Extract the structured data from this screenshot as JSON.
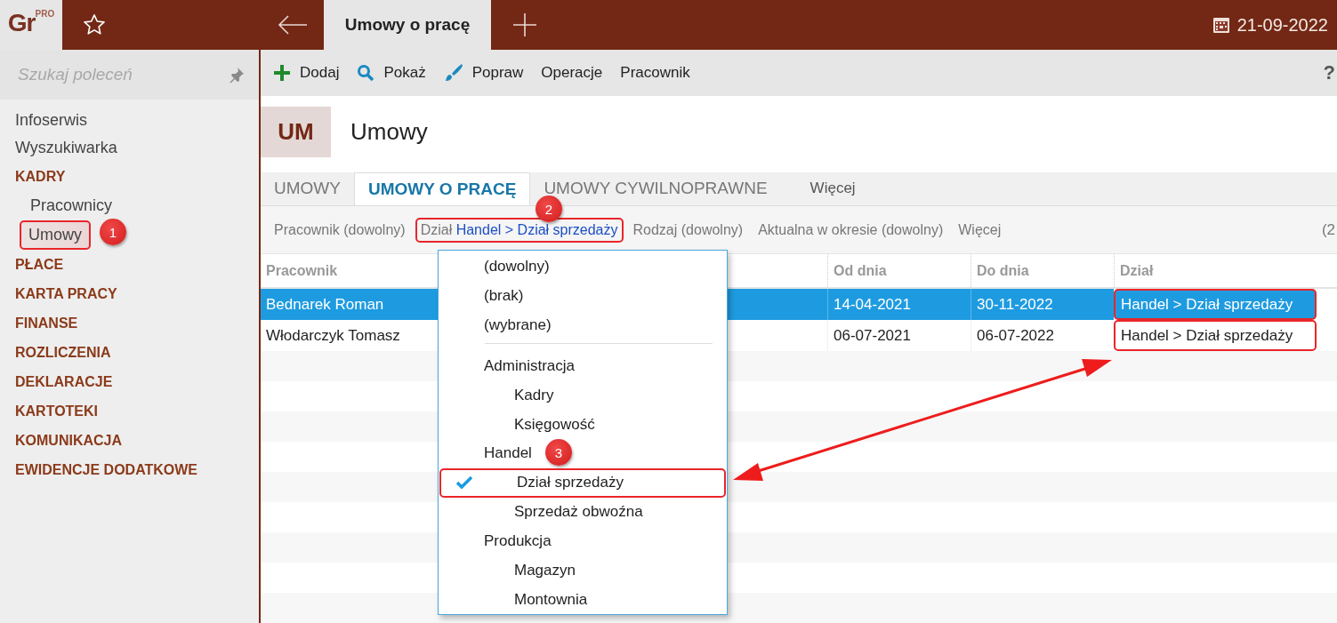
{
  "logo": {
    "text": "Gr",
    "badge": "PRO"
  },
  "title_bar": {
    "tabs": [
      {
        "label": "Umowy o pracę",
        "selected": true
      }
    ],
    "date": "21-09-2022"
  },
  "sidebar": {
    "search": {
      "placeholder": "Szukaj poleceń"
    },
    "items": [
      {
        "kind": "link",
        "label": "Infoserwis"
      },
      {
        "kind": "link",
        "label": "Wyszukiwarka"
      },
      {
        "kind": "section",
        "label": "KADRY",
        "children": [
          {
            "label": "Pracownicy",
            "selected": false
          },
          {
            "label": "Umowy",
            "selected": true
          }
        ]
      },
      {
        "kind": "section",
        "label": "PŁACE"
      },
      {
        "kind": "section",
        "label": "KARTA PRACY"
      },
      {
        "kind": "section",
        "label": "FINANSE"
      },
      {
        "kind": "section",
        "label": "ROZLICZENIA"
      },
      {
        "kind": "section",
        "label": "DEKLARACJE"
      },
      {
        "kind": "section",
        "label": "KARTOTEKI"
      },
      {
        "kind": "section",
        "label": "KOMUNIKACJA"
      },
      {
        "kind": "section",
        "label": "EWIDENCJE DODATKOWE"
      }
    ]
  },
  "toolbar": {
    "buttons": [
      {
        "label": "Dodaj",
        "kind": "add"
      },
      {
        "label": "Pokaż",
        "kind": "show"
      },
      {
        "label": "Popraw",
        "kind": "edit"
      },
      {
        "label": "Operacje",
        "kind": "text"
      },
      {
        "label": "Pracownik",
        "kind": "text"
      }
    ],
    "help": "?"
  },
  "header": {
    "badge": "UM",
    "title": "Umowy"
  },
  "tabs": [
    {
      "label": "UMOWY",
      "selected": false
    },
    {
      "label": "UMOWY O PRACĘ",
      "selected": true
    },
    {
      "label": "UMOWY CYWILNOPRAWNE",
      "selected": false
    },
    {
      "label": "Więcej",
      "selected": false
    }
  ],
  "filters": {
    "items": [
      {
        "label": "Pracownik",
        "value": "(dowolny)",
        "set": false
      },
      {
        "label": "Dział",
        "value": "Handel > Dział sprzedaży",
        "set": true
      },
      {
        "label": "Rodzaj",
        "value": "(dowolny)",
        "set": false
      },
      {
        "label": "Aktualna w okresie",
        "value": "(dowolny)",
        "set": false
      }
    ],
    "more": "Więcej",
    "count": "(2"
  },
  "table": {
    "columns": [
      "Pracownik",
      "Od dnia",
      "Do dnia",
      "Dział"
    ],
    "rows": [
      {
        "selected": true,
        "cells": [
          "Bednarek Roman",
          "14-04-2021",
          "30-11-2022",
          "Handel > Dział sprzedaży"
        ]
      },
      {
        "selected": false,
        "cells": [
          "Włodarczyk Tomasz",
          "06-07-2021",
          "06-07-2022",
          "Handel > Dział sprzedaży"
        ]
      }
    ]
  },
  "filter_dropdown": {
    "options": [
      {
        "label": "(dowolny)",
        "checked": false
      },
      {
        "label": "(brak)",
        "checked": false
      },
      {
        "label": "(wybrane)",
        "checked": false
      }
    ],
    "departments": [
      {
        "label": "Administracja",
        "checked": false,
        "children": [
          {
            "label": "Kadry",
            "checked": false
          },
          {
            "label": "Księgowość",
            "checked": false
          }
        ]
      },
      {
        "label": "Handel",
        "checked": false,
        "children": [
          {
            "label": "Dział sprzedaży",
            "checked": true
          },
          {
            "label": "Sprzedaż obwoźna",
            "checked": false
          }
        ]
      },
      {
        "label": "Produkcja",
        "checked": false,
        "children": [
          {
            "label": "Magazyn",
            "checked": false
          },
          {
            "label": "Montownia",
            "checked": false
          }
        ]
      }
    ]
  },
  "annotations": {
    "badges": [
      {
        "label": "1"
      },
      {
        "label": "2"
      },
      {
        "label": "3"
      }
    ]
  }
}
